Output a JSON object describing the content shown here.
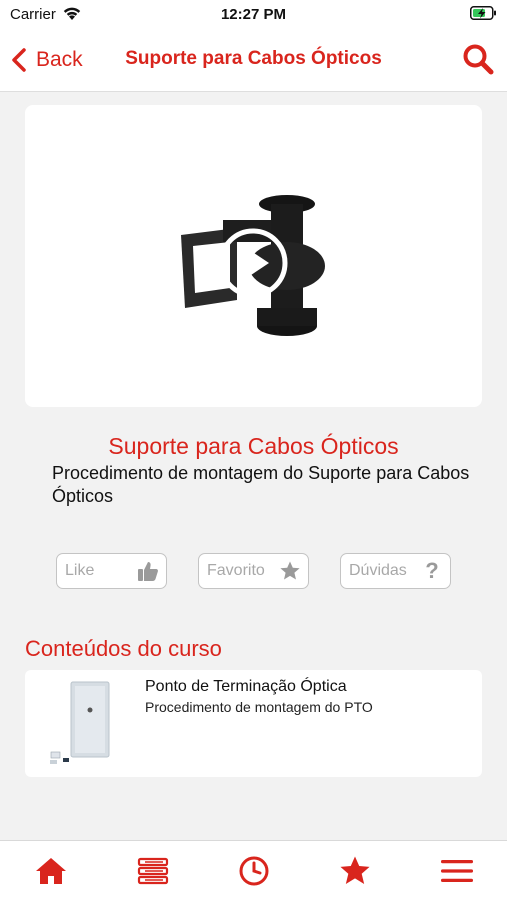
{
  "status_bar": {
    "carrier": "Carrier",
    "time": "12:27 PM"
  },
  "nav": {
    "back_label": "Back",
    "title": "Suporte para Cabos Ópticos"
  },
  "course": {
    "title": "Suporte para Cabos Ópticos",
    "description": "Procedimento de montagem do Suporte para Cabos Ópticos"
  },
  "actions": {
    "like_label": "Like",
    "favorite_label": "Favorito",
    "questions_label": "Dúvidas",
    "questions_icon": "?"
  },
  "contents": {
    "section_title": "Conteúdos do curso",
    "items": [
      {
        "title": "Ponto de Terminação Óptica",
        "subtitle": "Procedimento de montagem do PTO"
      }
    ]
  },
  "colors": {
    "accent": "#d9251d",
    "background": "#f2f2f2",
    "card": "#ffffff",
    "button_border": "#c4c4c4",
    "button_text": "#a8a8a8"
  },
  "icons": {
    "nav": [
      "back-chevron-icon",
      "search-icon"
    ],
    "actions": [
      "thumbs-up-icon",
      "star-icon",
      "question-icon"
    ],
    "tabs": [
      "home-icon",
      "library-icon",
      "clock-icon",
      "star-icon",
      "menu-icon"
    ]
  }
}
